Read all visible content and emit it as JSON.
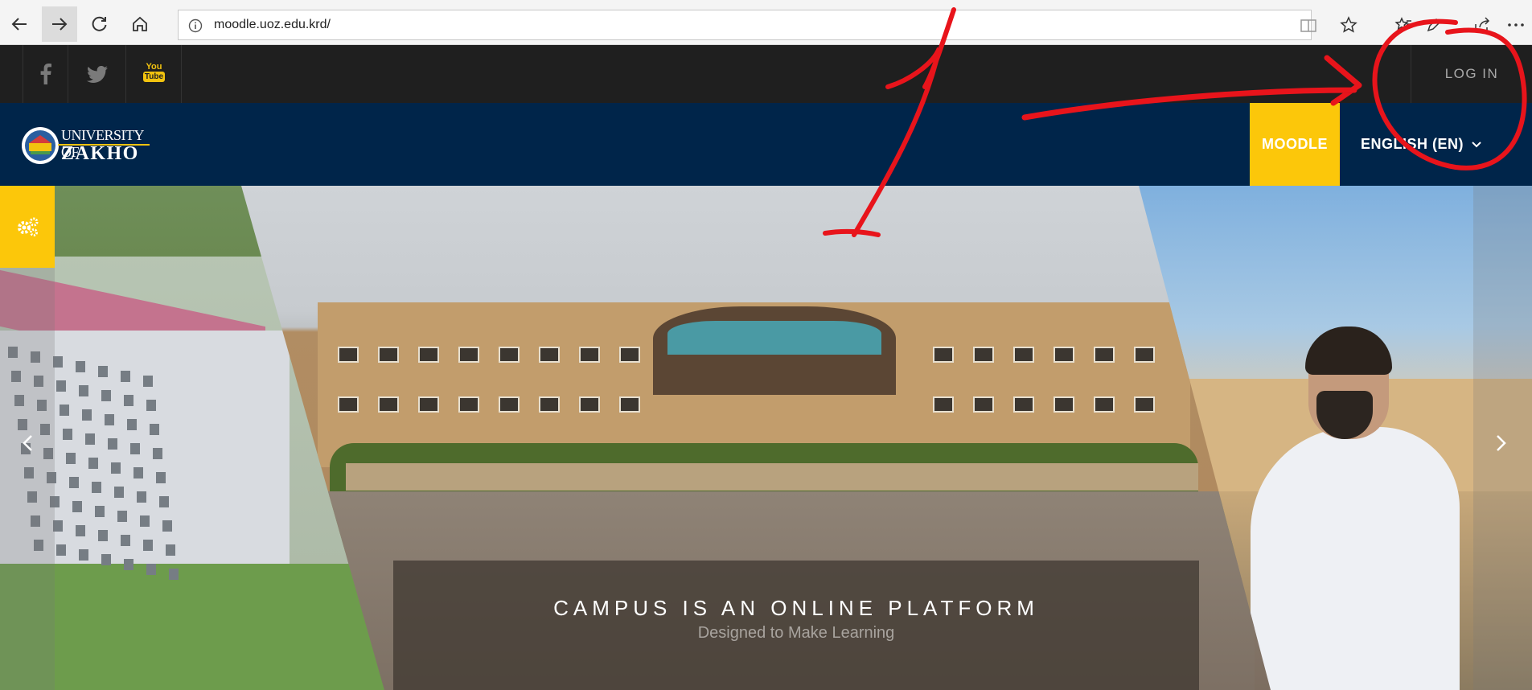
{
  "browser": {
    "url": "moodle.uoz.edu.krd/"
  },
  "site": {
    "login_label": "LOG IN",
    "logo_line1": "UNIVERSITY OF",
    "logo_line2": "ZAKHO",
    "moodle_label": "MOODLE",
    "language_label": "ENGLISH (EN)",
    "social_icons": [
      "facebook-icon",
      "twitter-icon",
      "youtube-icon"
    ],
    "youtube_text_top": "You",
    "youtube_text_bottom": "Tube"
  },
  "slider": {
    "caption_title": "CAMPUS IS AN ONLINE PLATFORM",
    "caption_subtitle": "Designed to Make Learning"
  },
  "annotation": {
    "number": "1",
    "color": "#e8141b"
  },
  "colors": {
    "header_bg": "#00254a",
    "accent_yellow": "#fcc70a",
    "topbar_bg": "#1f1f1f"
  }
}
